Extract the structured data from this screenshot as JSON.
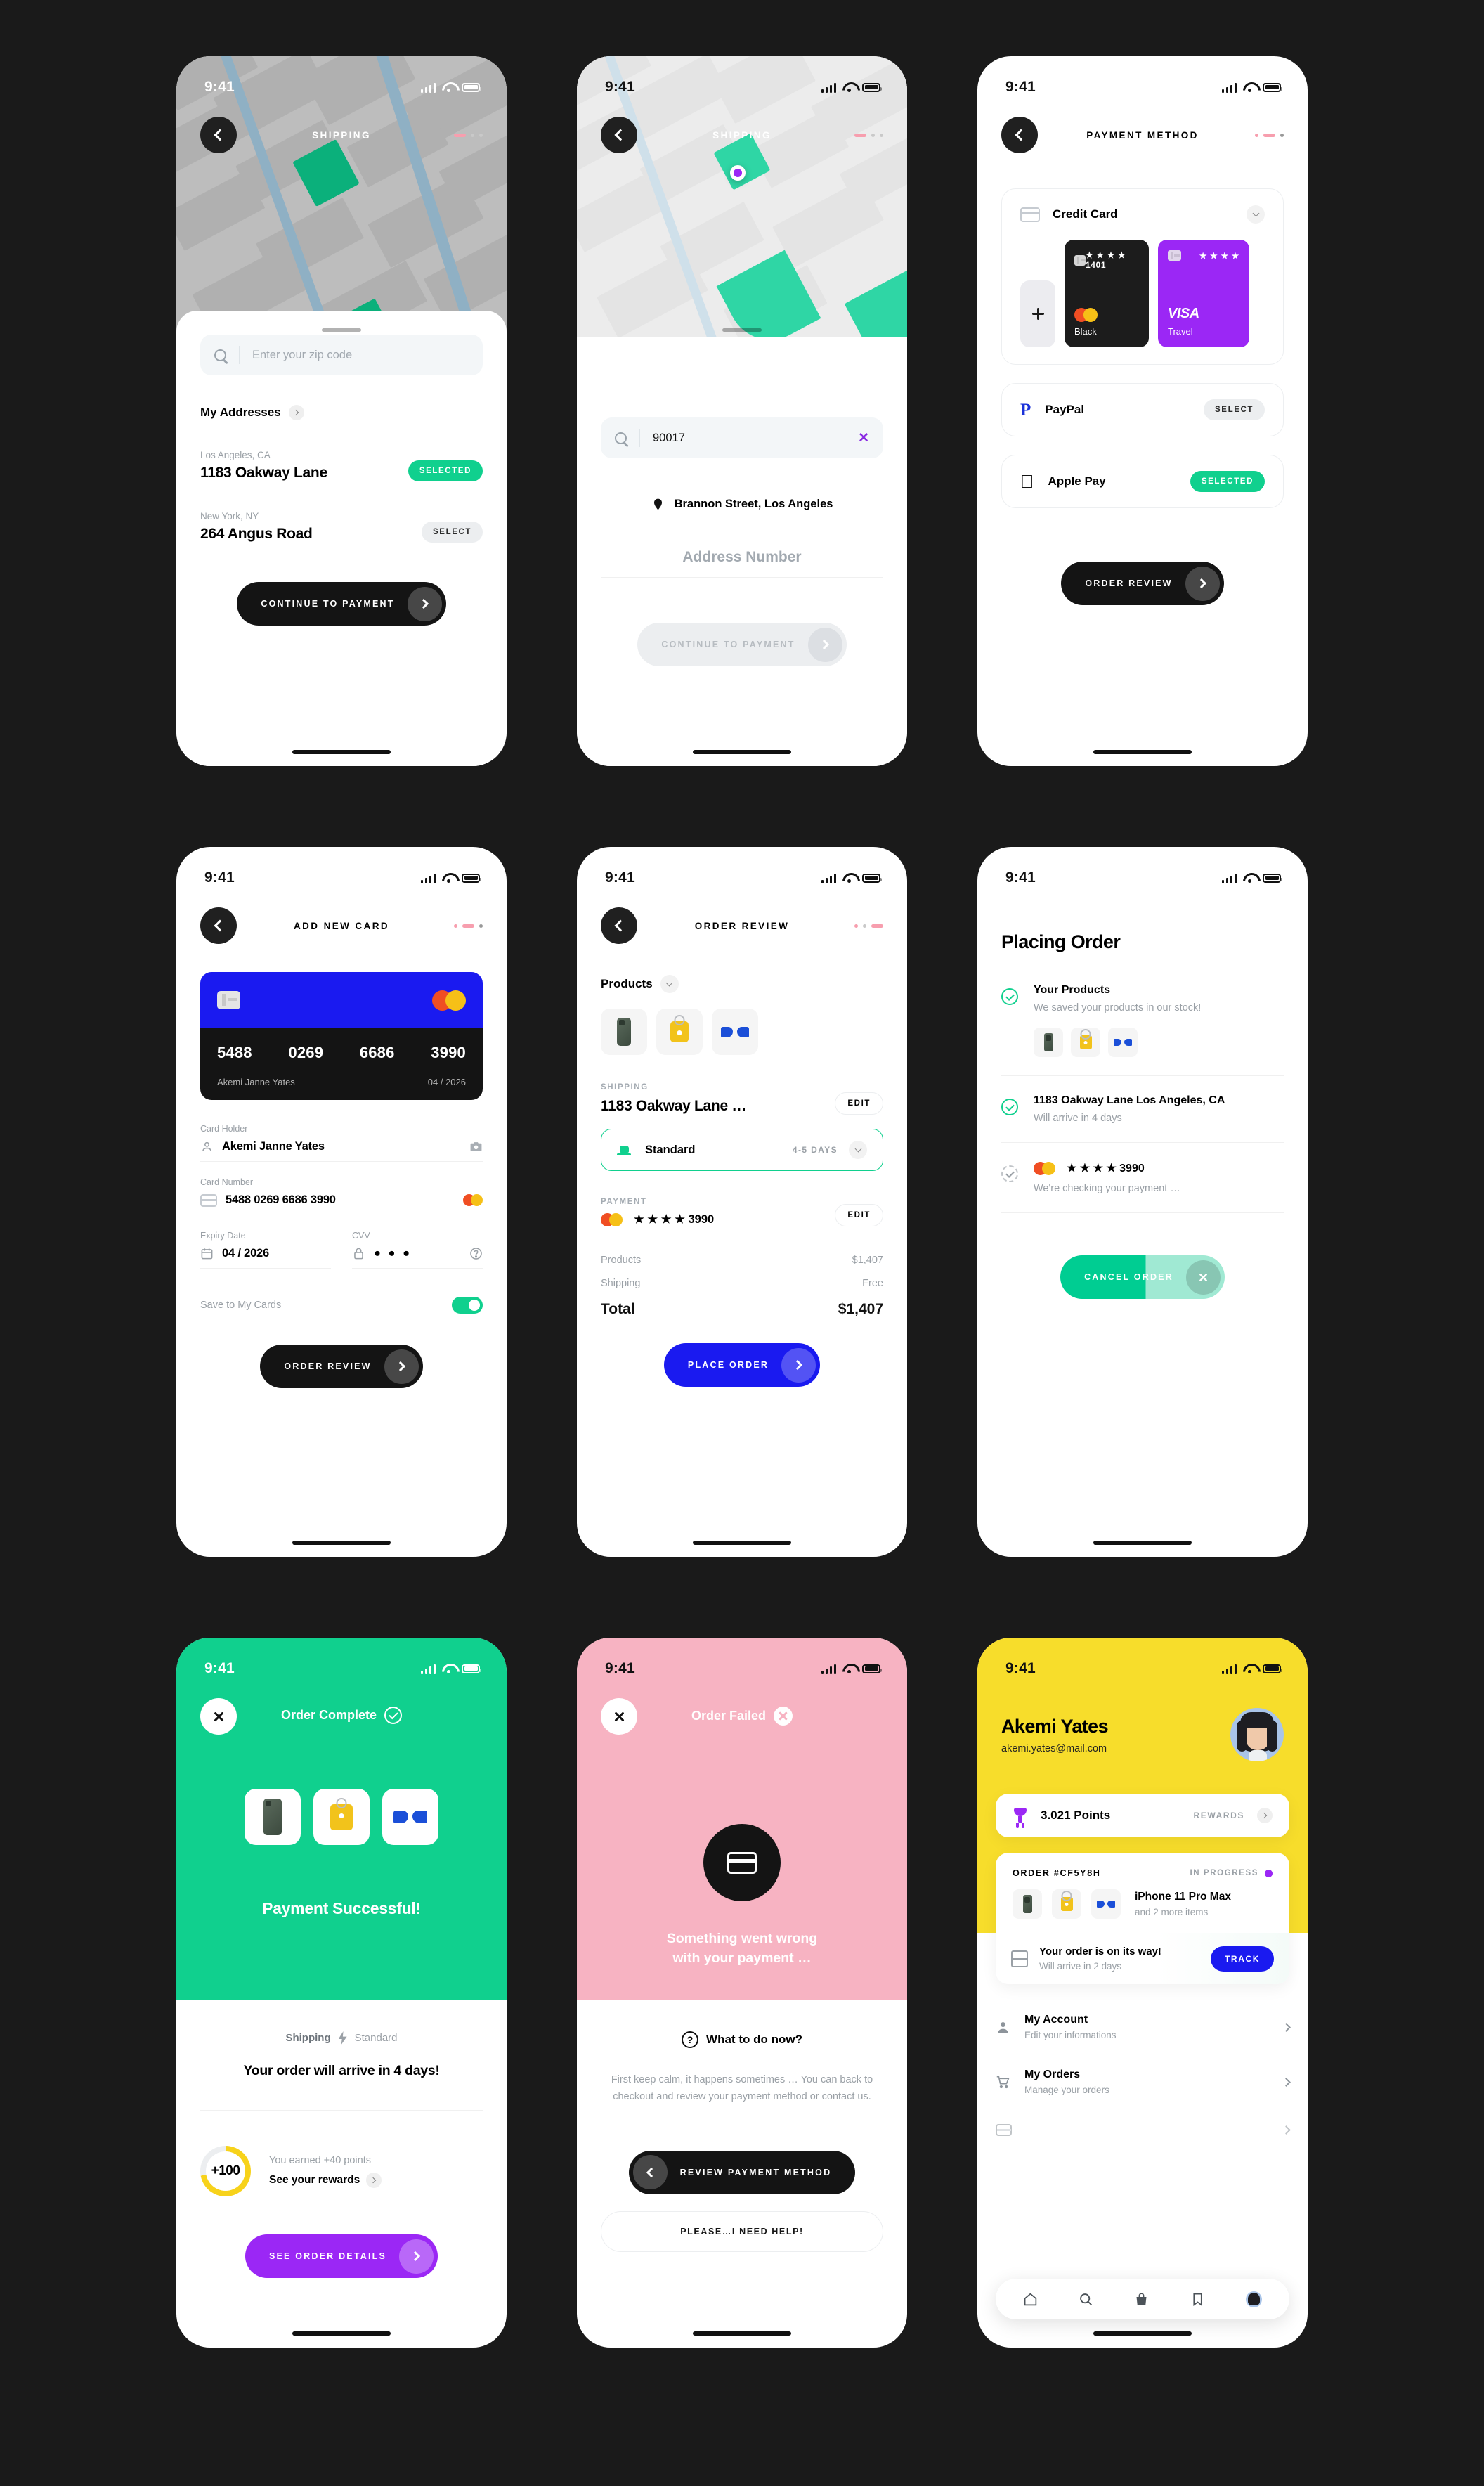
{
  "status_bar": {
    "time": "9:41"
  },
  "screens": {
    "shipping_addresses": {
      "nav_title": "SHIPPING",
      "search_placeholder": "Enter your zip code",
      "section_title": "My Addresses",
      "addresses": [
        {
          "city": "Los Angeles, CA",
          "street": "1183 Oakway Lane",
          "action": "SELECTED",
          "state": "selected"
        },
        {
          "city": "New York, NY",
          "street": "264 Angus Road",
          "action": "SELECT",
          "state": "unselected"
        }
      ],
      "cta": "CONTINUE TO PAYMENT"
    },
    "shipping_search": {
      "nav_title": "SHIPPING",
      "search_value": "90017",
      "clear_label": "✕",
      "result": "Brannon Street, Los Angeles",
      "address_number_placeholder": "Address Number",
      "cta": "CONTINUE TO PAYMENT"
    },
    "payment_method": {
      "nav_title": "PAYMENT METHOD",
      "credit_card_label": "Credit Card",
      "add_card_label": "+",
      "cards": [
        {
          "number": "★ ★ ★ ★ 1401",
          "name": "Black",
          "brand": "mastercard",
          "theme": "black"
        },
        {
          "number": "★ ★ ★ ★",
          "name": "Travel",
          "brand": "VISA",
          "theme": "purple"
        }
      ],
      "methods": [
        {
          "name": "PayPal",
          "action": "SELECT",
          "state": "unselected"
        },
        {
          "name": "Apple Pay",
          "action": "SELECTED",
          "state": "selected"
        }
      ],
      "cta": "ORDER REVIEW"
    },
    "add_new_card": {
      "nav_title": "ADD NEW CARD",
      "card_preview": {
        "number_groups": [
          "5488",
          "0269",
          "6686",
          "3990"
        ],
        "holder": "Akemi Janne Yates",
        "expiry": "04 / 2026"
      },
      "fields": [
        {
          "label": "Card Holder",
          "value": "Akemi Janne Yates"
        },
        {
          "label": "Card Number",
          "value": "5488 0269 6686 3990"
        },
        {
          "label": "Expiry Date",
          "value": "04 / 2026"
        },
        {
          "label": "CVV",
          "value": "● ● ●"
        }
      ],
      "save_toggle_label": "Save to My Cards",
      "save_toggle_on": true,
      "cta": "ORDER REVIEW"
    },
    "order_review": {
      "nav_title": "ORDER REVIEW",
      "products_label": "Products",
      "products": [
        "iphone",
        "keychain",
        "sunglasses"
      ],
      "shipping_label": "SHIPPING",
      "shipping_address": "1183 Oakway Lane …",
      "shipping_edit": "EDIT",
      "shipping_option": "Standard",
      "shipping_days": "4-5 DAYS",
      "payment_label": "PAYMENT",
      "payment_card": "★ ★ ★ ★ 3990",
      "payment_edit": "EDIT",
      "totals": [
        {
          "label": "Products",
          "value": "$1,407"
        },
        {
          "label": "Shipping",
          "value": "Free"
        }
      ],
      "total_label": "Total",
      "total_value": "$1,407",
      "cta": "PLACE ORDER"
    },
    "placing_order": {
      "title": "Placing Order",
      "steps": [
        {
          "heading": "Your Products",
          "sub": "We saved your products in our stock!",
          "state": "done",
          "has_products": true
        },
        {
          "heading": "1183 Oakway Lane Los Angeles, CA",
          "sub": "Will arrive in 4 days",
          "state": "done",
          "has_products": false
        },
        {
          "heading": "★ ★ ★ ★ 3990",
          "sub": "We're checking your payment …",
          "state": "pending",
          "has_products": false
        }
      ],
      "cta": "CANCEL ORDER"
    },
    "order_complete": {
      "title": "Order Complete",
      "message": "Payment Successful!",
      "shipping_label": "Shipping",
      "shipping_value": "Standard",
      "arrive": "Your order will arrive in 4 days!",
      "points_badge": "+100",
      "points_earned": "You earned +40 points",
      "rewards_link": "See your rewards",
      "cta": "SEE ORDER DETAILS"
    },
    "order_failed": {
      "title": "Order Failed",
      "message": "Something went wrong\nwith your payment …",
      "what_now": "What to do now?",
      "body": "First keep calm, it happens sometimes … You can back to checkout and review your payment method or contact us.",
      "cta_primary": "REVIEW PAYMENT METHOD",
      "cta_secondary": "PLEASE…I NEED HELP!"
    },
    "profile": {
      "name": "Akemi Yates",
      "email": "akemi.yates@mail.com",
      "points": "3.021 Points",
      "rewards_label": "REWARDS",
      "order_id": "ORDER #CF5Y8H",
      "order_status": "IN PROGRESS",
      "order_item": "iPhone 11 Pro Max",
      "order_more": "and 2 more items",
      "track_title": "Your order is on its way!",
      "track_sub": "Will arrive in 2 days",
      "track_button": "TRACK",
      "menu": [
        {
          "title": "My Account",
          "sub": "Edit your informations",
          "icon": "person-icon"
        },
        {
          "title": "My Orders",
          "sub": "Manage your orders",
          "icon": "cart-icon"
        }
      ]
    }
  },
  "colors": {
    "green": "#10d08e",
    "blue": "#1a1af0",
    "purple": "#9b27f5",
    "yellow": "#f7dd2b",
    "pink": "#f7b3c2",
    "dark": "#141414"
  }
}
